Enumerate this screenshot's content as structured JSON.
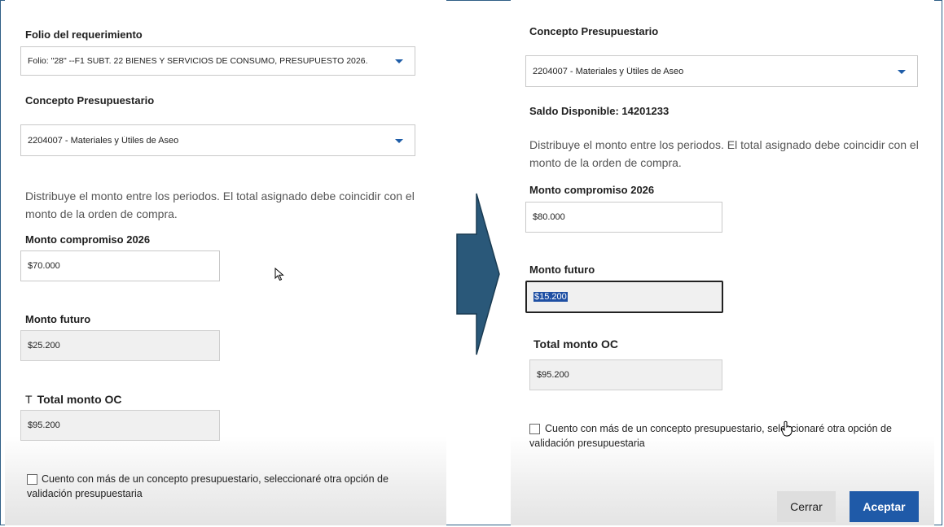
{
  "left": {
    "folio_label": "Folio del requerimiento",
    "folio_value": "Folio: \"28\" --F1 SUBT. 22 BIENES Y SERVICIOS DE CONSUMO, PRESUPUESTO 2026.",
    "concepto_label": "Concepto Presupuestario",
    "concepto_value": "2204007 - Materiales y Útiles de Aseo",
    "hint": "Distribuye el monto entre los periodos. El total asignado debe coincidir con el monto de la orden de compra.",
    "compromiso_label": "Monto compromiso 2026",
    "compromiso_value": "$70.000",
    "futuro_label": "Monto futuro",
    "futuro_value": "$25.200",
    "total_prefix": "T",
    "total_label": "Total monto OC",
    "total_value": "$95.200",
    "checkbox_label": "Cuento con más de un concepto presupuestario, seleccionaré otra opción de validación presupuestaria"
  },
  "right": {
    "concepto_label": "Concepto Presupuestario",
    "concepto_value": "2204007 - Materiales y Útiles de Aseo",
    "saldo": "Saldo Disponible: 14201233",
    "hint": "Distribuye el monto entre los periodos. El total asignado debe coincidir con el monto de la orden de compra.",
    "compromiso_label": "Monto compromiso 2026",
    "compromiso_value": "$80.000",
    "futuro_label": "Monto futuro",
    "futuro_value": "$15.200",
    "total_label": "Total monto OC",
    "total_value": "$95.200",
    "checkbox_label": "Cuento con más de un concepto presupuestario, seleccionaré otra opción de validación presupuestaria",
    "cerrar_label": "Cerrar",
    "aceptar_label": "Aceptar"
  },
  "icons": {
    "arrow": "right-arrow-icon",
    "pointer": "mouse-pointer-icon",
    "hand": "hand-cursor-icon",
    "dropdown": "chevron-down-icon"
  },
  "colors": {
    "arrow_fill": "#2a5879",
    "accent": "#1f5aa8",
    "frame": "#2f5f86"
  }
}
